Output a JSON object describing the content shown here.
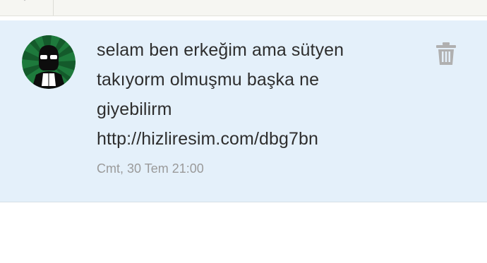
{
  "toolbar": {
    "back_icon": "chevron-icon"
  },
  "message": {
    "avatar_icon": "user-avatar",
    "lines": [
      "selam ben erkeğim ama sütyen",
      "takıyorm olmuşmu başka ne",
      "giyebilirm",
      "http://hizliresim.com/dbg7bn"
    ],
    "timestamp": "Cmt, 30 Tem 21:00",
    "delete_icon": "trash-icon"
  },
  "colors": {
    "card_background": "#e4f0fa",
    "avatar_background": "#1e7a3c",
    "text": "#2e2e2e",
    "timestamp": "#9a9a9a",
    "icon": "#b0b0b0"
  }
}
